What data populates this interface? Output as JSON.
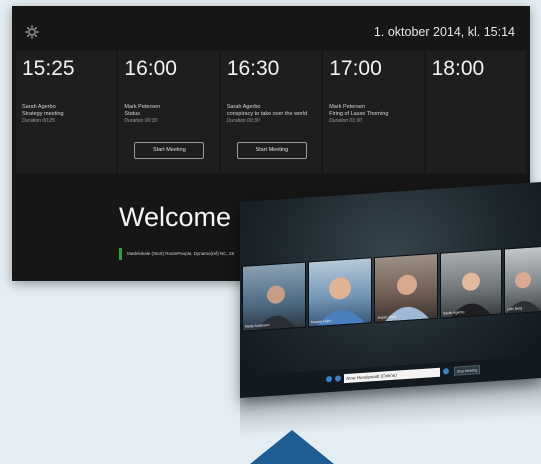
{
  "room": {
    "clock": "1. oktober 2014, kl. 15:14",
    "schedule": [
      {
        "time": "15:25",
        "organizer": "Sarah Agerbo",
        "subject": "Strategy meeting",
        "duration": "Duration 00:25",
        "button": ""
      },
      {
        "time": "16:00",
        "organizer": "Mark Petersen",
        "subject": "Status",
        "duration": "Duration 00:30",
        "button": "Start Meeting"
      },
      {
        "time": "16:30",
        "organizer": "Sarah Agerbo",
        "subject": "conspiracy to take over the world",
        "duration": "Duration 00:30",
        "button": "Start Meeting"
      },
      {
        "time": "17:00",
        "organizer": "Mark Petersen",
        "subject": "Firing of Lasse Thorning",
        "duration": "Duration 01:00",
        "button": ""
      },
      {
        "time": "18:00",
        "organizer": "",
        "subject": "",
        "duration": "",
        "button": ""
      }
    ],
    "welcome": "Welcome",
    "ticker": "Mødelokale (Stort) RoomPeople, Dynamo(ref) NC, 28"
  },
  "video": {
    "participants": [
      {
        "name": "Mette Andersen"
      },
      {
        "name": "Kasper Holm"
      },
      {
        "name": "Jesper Koch"
      },
      {
        "name": "Sarah Agerbo"
      },
      {
        "name": "Lars Berg"
      }
    ],
    "call_input": "Arne Hundewadt (Online)",
    "call_button": "Stop Meeting"
  },
  "colors": {
    "accent": "#1e5d94",
    "green": "#2f9e3f"
  }
}
